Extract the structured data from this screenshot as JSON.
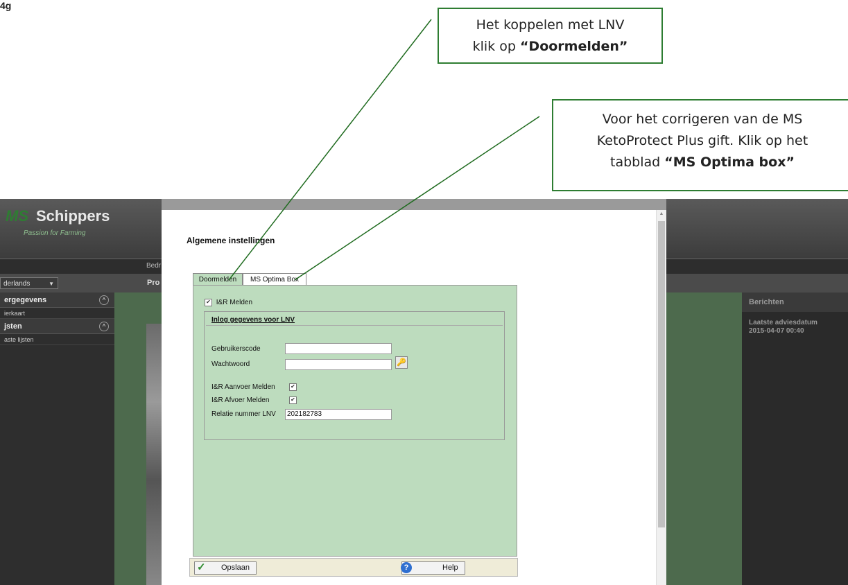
{
  "corner_mark": "4g",
  "callouts": {
    "first": {
      "line1": "Het koppelen met LNV",
      "line2_prefix": "klik op ",
      "line2_bold": "“Doormelden”"
    },
    "second": {
      "line1": "Voor het corrigeren van de MS",
      "line2": "KetoProtect Plus gift. Klik op het",
      "line3_prefix": "tabblad ",
      "line3_bold": "“MS Optima box”"
    }
  },
  "app": {
    "logo_ms": "MS",
    "logo_name": "Schippers",
    "logo_tagline": "Passion for Farming",
    "nav_partial": "Bedr",
    "language": "derlands",
    "prog_partial": "Pro",
    "left_panel": {
      "section1": "ergegevens",
      "section1_item": "ierkaart",
      "section2": "jsten",
      "section2_item": "aste lijsten"
    },
    "right_panel": {
      "header": "Berichten",
      "label": "Laatste adviesdatum",
      "date": "2015-04-07 00:40"
    }
  },
  "modal": {
    "title": "Algemene instellingen",
    "tabs": [
      {
        "label": "Doormelden",
        "active": true
      },
      {
        "label": "MS Optima Box",
        "active": false
      }
    ],
    "ir_melden_label": "I&R Melden",
    "ir_melden_checked": true,
    "fieldset_legend": "Inlog gegevens voor LNV",
    "gebruikerscode_label": "Gebruikerscode",
    "gebruikerscode_value": "",
    "wachtwoord_label": "Wachtwoord",
    "wachtwoord_value": "",
    "aanvoer_label": "I&R Aanvoer Melden",
    "aanvoer_checked": true,
    "afvoer_label": "I&R Afvoer Melden",
    "afvoer_checked": true,
    "relatie_label": "Relatie nummer LNV",
    "relatie_value": "202182783",
    "save_label": "Opslaan",
    "help_label": "Help"
  },
  "colors": {
    "callout_border": "#2e7d32",
    "annotation_line": "#1f6b1f",
    "panel_green": "#bddcbe"
  }
}
